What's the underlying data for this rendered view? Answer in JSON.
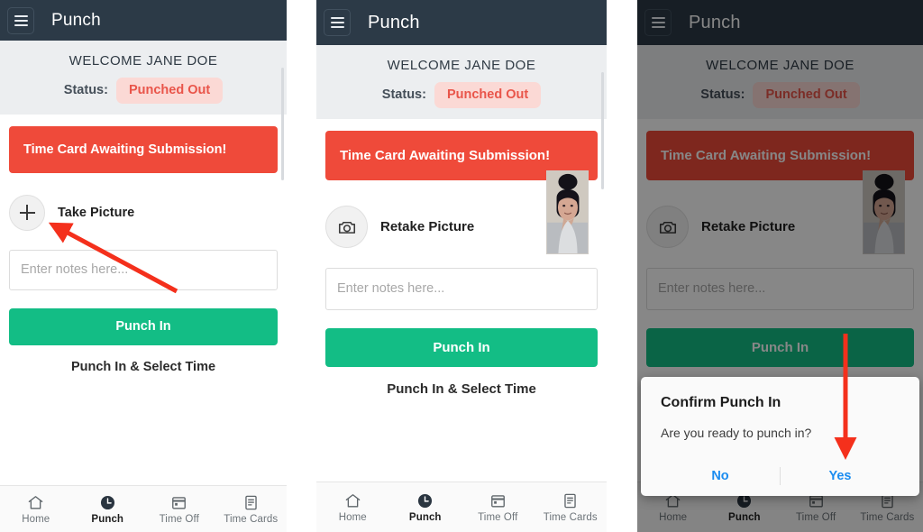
{
  "app": {
    "title": "Punch",
    "menu_icon": "hamburger-menu-icon"
  },
  "colors": {
    "appbar": "#2c3a47",
    "banner_red": "#ef4a3a",
    "punch_green": "#13bd85",
    "status_badge_bg": "#fbd9d5",
    "status_badge_text": "#e9554a",
    "dialog_action": "#1a8cf0",
    "annotation_arrow": "#f4301c"
  },
  "welcome": {
    "greeting": "WELCOME JANE DOE",
    "status_label": "Status:",
    "status_value": "Punched Out"
  },
  "banner": {
    "text": "Time Card Awaiting Submission!"
  },
  "picture": {
    "take_label": "Take Picture",
    "retake_label": "Retake Picture",
    "take_icon": "plus-icon",
    "retake_icon": "camera-icon",
    "thumbnail_alt": "employee-photo"
  },
  "notes": {
    "placeholder": "Enter notes here...",
    "value": ""
  },
  "actions": {
    "punch_in": "Punch In",
    "punch_in_select_time": "Punch In & Select Time"
  },
  "bottom_nav": {
    "items": [
      {
        "label": "Home",
        "icon": "home-icon",
        "active": false
      },
      {
        "label": "Punch",
        "icon": "clock-icon",
        "active": true
      },
      {
        "label": "Time Off",
        "icon": "calendar-icon",
        "active": false
      },
      {
        "label": "Time Cards",
        "icon": "document-icon",
        "active": false
      }
    ]
  },
  "dialog": {
    "title": "Confirm Punch In",
    "message": "Are you ready to punch in?",
    "no_label": "No",
    "yes_label": "Yes"
  },
  "annotations": [
    {
      "name": "arrow-to-take-picture",
      "panel": 1,
      "points_at": "Take Picture"
    },
    {
      "name": "arrow-to-yes-button",
      "panel": 3,
      "points_at": "Yes"
    }
  ]
}
